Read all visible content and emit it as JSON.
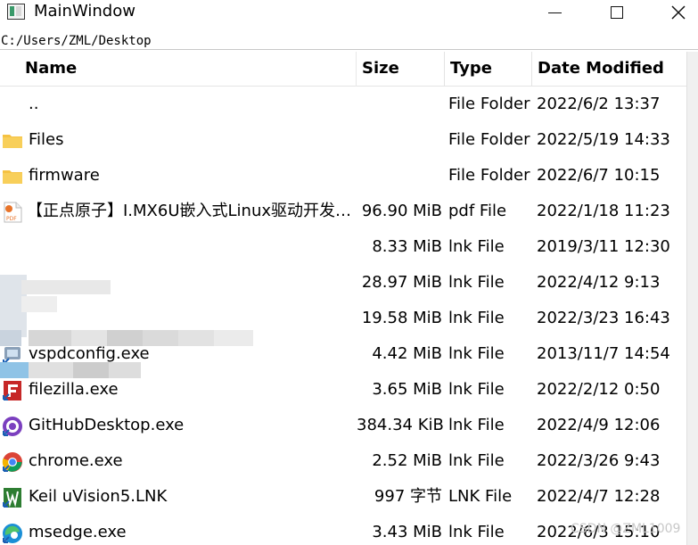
{
  "window": {
    "title": "MainWindow"
  },
  "path": "C:/Users/ZML/Desktop",
  "columns": {
    "name": "Name",
    "size": "Size",
    "type": "Type",
    "date": "Date Modified"
  },
  "rows": [
    {
      "icon": "none",
      "name": "..",
      "size": "",
      "type": "File Folder",
      "date": "2022/6/2 13:37"
    },
    {
      "icon": "folder-icon",
      "name": "Files",
      "size": "",
      "type": "File Folder",
      "date": "2022/5/19 14:33"
    },
    {
      "icon": "folder-icon",
      "name": "firmware",
      "size": "",
      "type": "File Folder",
      "date": "2022/6/7 10:15"
    },
    {
      "icon": "pdf-icon",
      "name": "【正点原子】I.MX6U嵌入式Linux驱动开发…",
      "size": "96.90 MiB",
      "type": "pdf File",
      "date": "2022/1/18 11:23"
    },
    {
      "icon": "blurred",
      "name": "",
      "size": "8.33 MiB",
      "type": "lnk File",
      "date": "2019/3/11 12:30"
    },
    {
      "icon": "blurred",
      "name": "",
      "size": "28.97 MiB",
      "type": "lnk File",
      "date": "2022/4/12 9:13"
    },
    {
      "icon": "blurred",
      "name": "",
      "size": "19.58 MiB",
      "type": "lnk File",
      "date": "2022/3/23 16:43"
    },
    {
      "icon": "vspd-icon",
      "name": "vspdconfig.exe",
      "size": "4.42 MiB",
      "type": "lnk File",
      "date": "2013/11/7 14:54"
    },
    {
      "icon": "filezilla-icon",
      "name": "filezilla.exe",
      "size": "3.65 MiB",
      "type": "lnk File",
      "date": "2022/2/12 0:50"
    },
    {
      "icon": "github-desktop-icon",
      "name": "GitHubDesktop.exe",
      "size": "384.34 KiB",
      "type": "lnk File",
      "date": "2022/4/9 12:06"
    },
    {
      "icon": "chrome-icon",
      "name": "chrome.exe",
      "size": "2.52 MiB",
      "type": "lnk File",
      "date": "2022/3/26 9:43"
    },
    {
      "icon": "keil-icon",
      "name": "Keil uVision5.LNK",
      "size": "997 字节",
      "type": "LNK File",
      "date": "2022/4/7 12:28"
    },
    {
      "icon": "edge-icon",
      "name": "msedge.exe",
      "size": "3.43 MiB",
      "type": "lnk File",
      "date": "2022/6/3 15:10"
    }
  ],
  "watermark": "CSDN @ZML1009",
  "colors": {
    "folder": "#f5c242",
    "pdf": "#e8742a",
    "filezilla": "#c62828",
    "github": "#7b3fbf",
    "keil": "#2e7d32",
    "edge": "#1a8fd6"
  }
}
